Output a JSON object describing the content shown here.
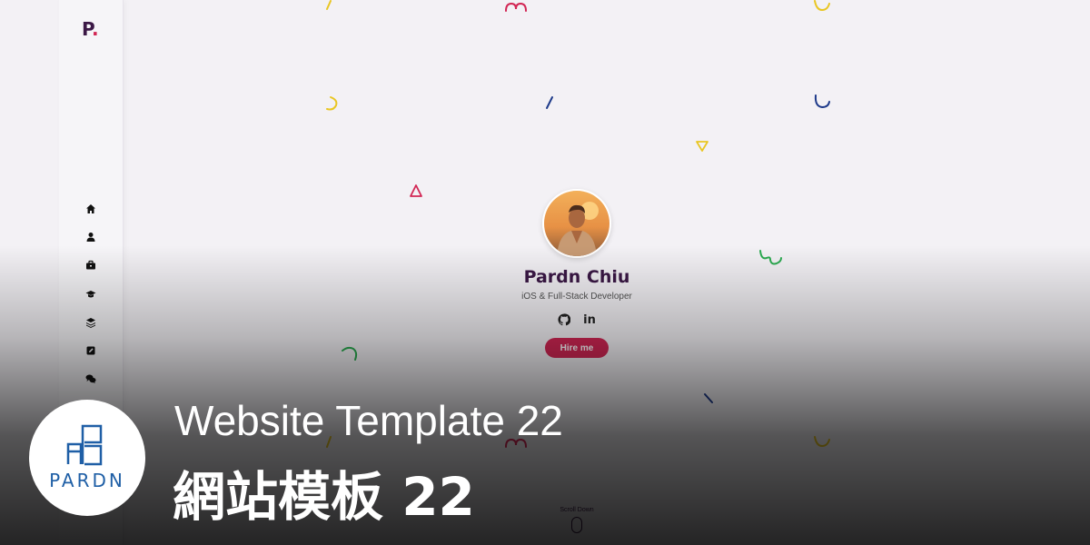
{
  "site": {
    "logo_letter": "P",
    "logo_dot": ".",
    "accent": "#d22654",
    "primary": "#3b1846"
  },
  "nav": [
    {
      "icon": "home-icon"
    },
    {
      "icon": "user-icon"
    },
    {
      "icon": "briefcase-icon"
    },
    {
      "icon": "graduation-cap-icon"
    },
    {
      "icon": "layers-icon"
    },
    {
      "icon": "edit-icon"
    },
    {
      "icon": "chat-icon"
    }
  ],
  "profile": {
    "name": "Pardn Chiu",
    "role": "iOS & Full-Stack Developer",
    "socials": [
      {
        "icon": "github-icon"
      },
      {
        "label": "in",
        "icon": "linkedin-icon"
      }
    ],
    "cta": "Hire me"
  },
  "scroll": {
    "label": "Scroll Down"
  },
  "banner": {
    "title": "Website Template 22",
    "subtitle": "網站模板 22",
    "brand": "PARDN"
  }
}
